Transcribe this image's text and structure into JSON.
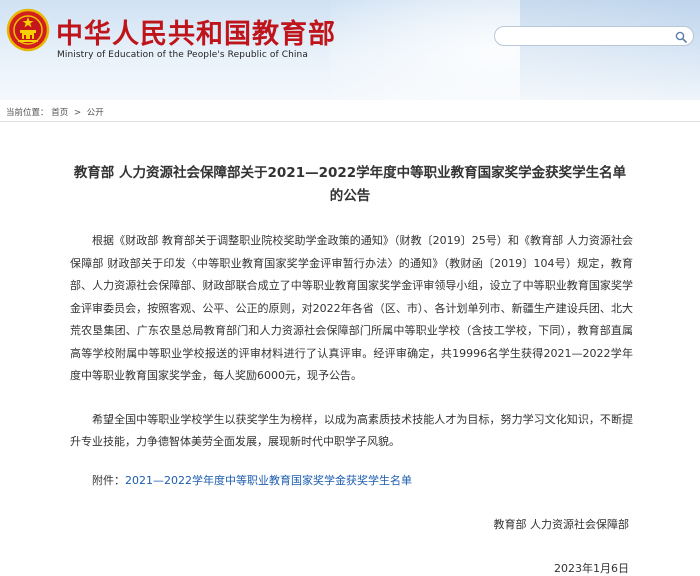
{
  "header": {
    "site_title": "中华人民共和国教育部",
    "site_subtitle": "Ministry of Education of the People's Republic of China",
    "emblem_icon": "national-emblem-icon",
    "search": {
      "placeholder": "",
      "icon": "search-icon"
    }
  },
  "breadcrumb": {
    "label": "当前位置：",
    "items": [
      "首页",
      "公开"
    ],
    "separator": ">"
  },
  "article": {
    "title": "教育部 人力资源社会保障部关于2021—2022学年度中等职业教育国家奖学金获奖学生名单的公告",
    "paragraphs": [
      "根据《财政部 教育部关于调整职业院校奖助学金政策的通知》（财教〔2019〕25号）和《教育部 人力资源社会保障部 财政部关于印发〈中等职业教育国家奖学金评审暂行办法〉的通知》（教财函〔2019〕104号）规定，教育部、人力资源社会保障部、财政部联合成立了中等职业教育国家奖学金评审领导小组，设立了中等职业教育国家奖学金评审委员会，按照客观、公平、公正的原则，对2022年各省（区、市）、各计划单列市、新疆生产建设兵团、北大荒农垦集团、广东农垦总局教育部门和人力资源社会保障部门所属中等职业学校（含技工学校，下同），教育部直属高等学校附属中等职业学校报送的评审材料进行了认真评审。经评审确定，共19996名学生获得2021—2022学年度中等职业教育国家奖学金，每人奖励6000元，现予公告。",
      "希望全国中等职业学校学生以获奖学生为榜样，以成为高素质技术技能人才为目标，努力学习文化知识，不断提升专业技能，力争德智体美劳全面发展，展现新时代中职学子风貌。"
    ],
    "attachment_label": "附件：",
    "attachment_link": "2021—2022学年度中等职业教育国家奖学金获奖学生名单",
    "signature": "教育部 人力资源社会保障部",
    "date": "2023年1月6日"
  },
  "colors": {
    "title_red": "#c0141b",
    "link_blue": "#1c5db0",
    "header_sky": "#cfe1f3"
  }
}
